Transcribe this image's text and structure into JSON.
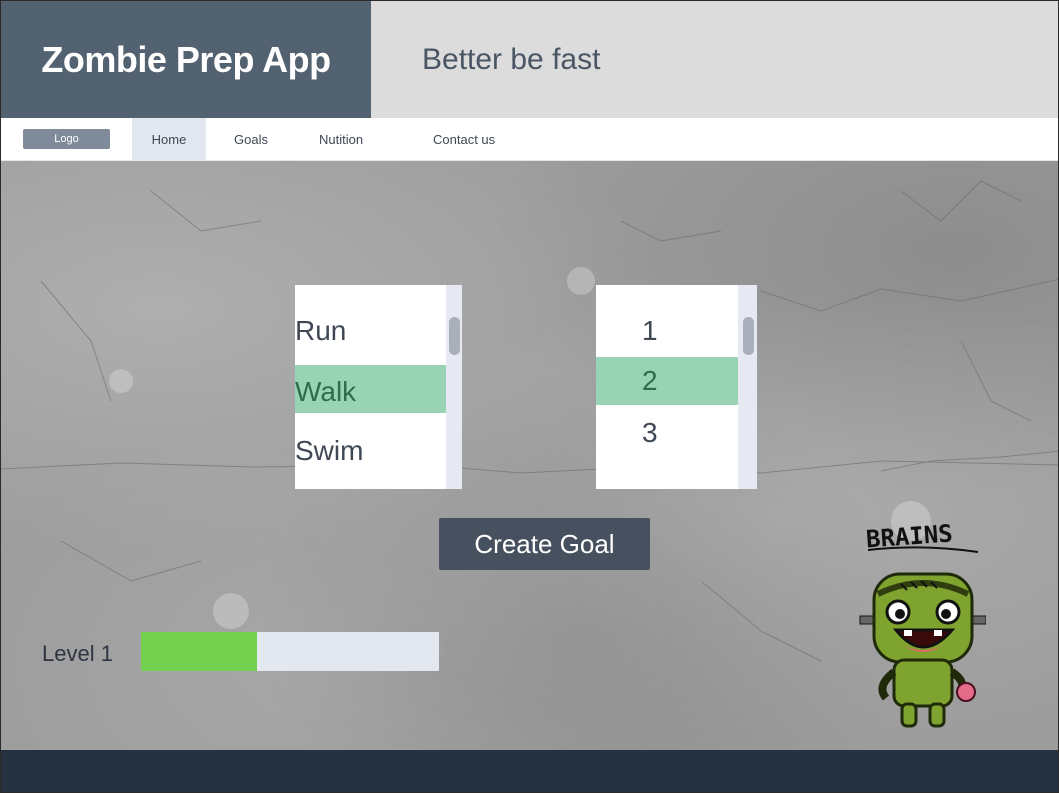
{
  "header": {
    "app_title": "Zombie Prep App",
    "tagline": "Better be fast"
  },
  "nav": {
    "logo_label": "Logo",
    "items": [
      "Home",
      "Goals",
      "Nutition",
      "Contact us"
    ],
    "active": "Home"
  },
  "activity_list": {
    "options": [
      "Run",
      "Walk",
      "Swim"
    ],
    "selected": "Walk"
  },
  "count_list": {
    "options": [
      "1",
      "2",
      "3"
    ],
    "selected": "2"
  },
  "create_goal_label": "Create Goal",
  "level": {
    "label": "Level 1",
    "progress": 0.39
  },
  "zombie": {
    "caption": "BRAINS"
  },
  "colors": {
    "brand": "#536270",
    "selected_row": "#99d3b5",
    "progress_fill": "#73d04f",
    "footer": "#263142",
    "zombie_skin": "#7ea32e"
  }
}
